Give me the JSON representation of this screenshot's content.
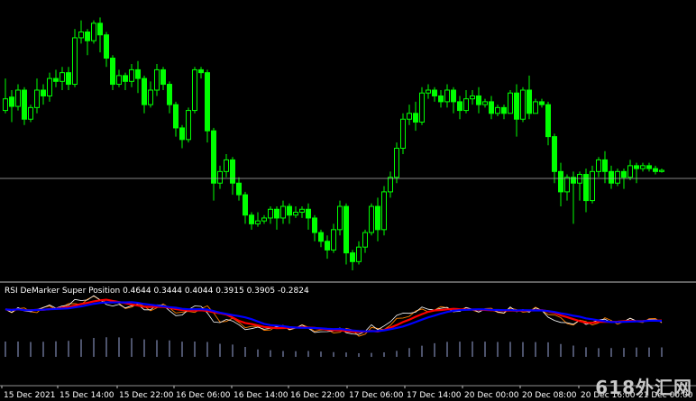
{
  "indicator": {
    "name": "RSI DeMarker Super Position",
    "values": [
      "0.4644",
      "0.3444",
      "0.4044",
      "0.3915",
      "0.3905",
      "-0.2824"
    ]
  },
  "watermark": "618外汇网",
  "colors": {
    "background": "#000000",
    "candle": "#00ff00",
    "wick": "#00ff00",
    "hline": "#c0c0c0",
    "separator": "#c0c0c0",
    "rsi_line": "#ffffff",
    "demarker_line": "#ff8000",
    "ma_red": "#ff0000",
    "ma_blue": "#0000ff",
    "histogram": "#9aa6d8"
  },
  "chart_data": {
    "type": "candlestick",
    "x_ticks": [
      "15 Dec 2021",
      "15 Dec 14:00",
      "15 Dec 22:00",
      "16 Dec 06:00",
      "16 Dec 14:00",
      "16 Dec 22:00",
      "17 Dec 06:00",
      "17 Dec 14:00",
      "20 Dec 00:00",
      "20 Dec 08:00",
      "20 Dec 16:00",
      "21 Dec 00:00"
    ],
    "price_hline": 0.5,
    "candles": [
      [
        0.605,
        0.625,
        0.6,
        0.66
      ],
      [
        0.628,
        0.612,
        0.585,
        0.64
      ],
      [
        0.612,
        0.64,
        0.605,
        0.65
      ],
      [
        0.64,
        0.59,
        0.58,
        0.645
      ],
      [
        0.59,
        0.61,
        0.585,
        0.615
      ],
      [
        0.61,
        0.64,
        0.6,
        0.66
      ],
      [
        0.64,
        0.63,
        0.615,
        0.65
      ],
      [
        0.63,
        0.66,
        0.62,
        0.67
      ],
      [
        0.66,
        0.655,
        0.645,
        0.675
      ],
      [
        0.655,
        0.67,
        0.64,
        0.68
      ],
      [
        0.67,
        0.65,
        0.64,
        0.68
      ],
      [
        0.65,
        0.73,
        0.645,
        0.745
      ],
      [
        0.73,
        0.74,
        0.72,
        0.76
      ],
      [
        0.74,
        0.725,
        0.7,
        0.745
      ],
      [
        0.725,
        0.755,
        0.72,
        0.76
      ],
      [
        0.755,
        0.735,
        0.705,
        0.765
      ],
      [
        0.735,
        0.695,
        0.68,
        0.74
      ],
      [
        0.695,
        0.65,
        0.64,
        0.7
      ],
      [
        0.65,
        0.665,
        0.645,
        0.675
      ],
      [
        0.665,
        0.655,
        0.64,
        0.67
      ],
      [
        0.655,
        0.675,
        0.645,
        0.685
      ],
      [
        0.675,
        0.66,
        0.635,
        0.69
      ],
      [
        0.66,
        0.615,
        0.6,
        0.665
      ],
      [
        0.615,
        0.64,
        0.61,
        0.655
      ],
      [
        0.64,
        0.675,
        0.63,
        0.685
      ],
      [
        0.675,
        0.65,
        0.64,
        0.68
      ],
      [
        0.65,
        0.615,
        0.6,
        0.655
      ],
      [
        0.615,
        0.575,
        0.56,
        0.62
      ],
      [
        0.575,
        0.555,
        0.54,
        0.58
      ],
      [
        0.555,
        0.605,
        0.55,
        0.61
      ],
      [
        0.605,
        0.675,
        0.6,
        0.68
      ],
      [
        0.675,
        0.67,
        0.66,
        0.68
      ],
      [
        0.67,
        0.57,
        0.55,
        0.675
      ],
      [
        0.57,
        0.48,
        0.45,
        0.575
      ],
      [
        0.48,
        0.5,
        0.47,
        0.51
      ],
      [
        0.5,
        0.52,
        0.49,
        0.53
      ],
      [
        0.52,
        0.48,
        0.46,
        0.525
      ],
      [
        0.48,
        0.46,
        0.45,
        0.49
      ],
      [
        0.46,
        0.425,
        0.41,
        0.465
      ],
      [
        0.425,
        0.41,
        0.4,
        0.43
      ],
      [
        0.41,
        0.415,
        0.405,
        0.43
      ],
      [
        0.415,
        0.42,
        0.41,
        0.425
      ],
      [
        0.42,
        0.435,
        0.41,
        0.44
      ],
      [
        0.435,
        0.42,
        0.4,
        0.44
      ],
      [
        0.42,
        0.44,
        0.41,
        0.45
      ],
      [
        0.44,
        0.425,
        0.41,
        0.445
      ],
      [
        0.425,
        0.43,
        0.42,
        0.44
      ],
      [
        0.43,
        0.435,
        0.42,
        0.44
      ],
      [
        0.435,
        0.42,
        0.4,
        0.445
      ],
      [
        0.42,
        0.395,
        0.38,
        0.425
      ],
      [
        0.395,
        0.38,
        0.37,
        0.4
      ],
      [
        0.38,
        0.365,
        0.35,
        0.39
      ],
      [
        0.365,
        0.4,
        0.36,
        0.41
      ],
      [
        0.4,
        0.44,
        0.39,
        0.45
      ],
      [
        0.44,
        0.36,
        0.34,
        0.445
      ],
      [
        0.36,
        0.345,
        0.33,
        0.365
      ],
      [
        0.345,
        0.37,
        0.34,
        0.38
      ],
      [
        0.37,
        0.395,
        0.36,
        0.4
      ],
      [
        0.395,
        0.44,
        0.39,
        0.445
      ],
      [
        0.44,
        0.4,
        0.38,
        0.455
      ],
      [
        0.4,
        0.465,
        0.39,
        0.475
      ],
      [
        0.465,
        0.49,
        0.455,
        0.5
      ],
      [
        0.49,
        0.54,
        0.48,
        0.55
      ],
      [
        0.54,
        0.59,
        0.53,
        0.6
      ],
      [
        0.59,
        0.6,
        0.58,
        0.615
      ],
      [
        0.6,
        0.585,
        0.57,
        0.62
      ],
      [
        0.585,
        0.635,
        0.58,
        0.645
      ],
      [
        0.635,
        0.64,
        0.625,
        0.65
      ],
      [
        0.64,
        0.63,
        0.62,
        0.645
      ],
      [
        0.63,
        0.62,
        0.61,
        0.64
      ],
      [
        0.62,
        0.64,
        0.61,
        0.65
      ],
      [
        0.64,
        0.62,
        0.6,
        0.645
      ],
      [
        0.62,
        0.605,
        0.59,
        0.63
      ],
      [
        0.605,
        0.625,
        0.6,
        0.64
      ],
      [
        0.625,
        0.63,
        0.615,
        0.64
      ],
      [
        0.63,
        0.615,
        0.6,
        0.645
      ],
      [
        0.615,
        0.62,
        0.61,
        0.625
      ],
      [
        0.62,
        0.6,
        0.59,
        0.63
      ],
      [
        0.6,
        0.61,
        0.595,
        0.615
      ],
      [
        0.61,
        0.6,
        0.59,
        0.615
      ],
      [
        0.6,
        0.635,
        0.6,
        0.64
      ],
      [
        0.635,
        0.59,
        0.56,
        0.65
      ],
      [
        0.59,
        0.64,
        0.585,
        0.645
      ],
      [
        0.64,
        0.6,
        0.59,
        0.665
      ],
      [
        0.6,
        0.62,
        0.6,
        0.625
      ],
      [
        0.62,
        0.615,
        0.61,
        0.625
      ],
      [
        0.615,
        0.56,
        0.545,
        0.62
      ],
      [
        0.56,
        0.5,
        0.48,
        0.565
      ],
      [
        0.5,
        0.465,
        0.44,
        0.515
      ],
      [
        0.465,
        0.49,
        0.45,
        0.495
      ],
      [
        0.49,
        0.48,
        0.41,
        0.5
      ],
      [
        0.48,
        0.495,
        0.45,
        0.5
      ],
      [
        0.495,
        0.45,
        0.43,
        0.505
      ],
      [
        0.45,
        0.5,
        0.445,
        0.51
      ],
      [
        0.5,
        0.52,
        0.49,
        0.525
      ],
      [
        0.52,
        0.5,
        0.48,
        0.535
      ],
      [
        0.5,
        0.48,
        0.47,
        0.51
      ],
      [
        0.48,
        0.5,
        0.475,
        0.505
      ],
      [
        0.5,
        0.49,
        0.47,
        0.505
      ],
      [
        0.49,
        0.51,
        0.485,
        0.52
      ],
      [
        0.51,
        0.505,
        0.48,
        0.515
      ],
      [
        0.505,
        0.51,
        0.5,
        0.515
      ],
      [
        0.51,
        0.505,
        0.5,
        0.515
      ],
      [
        0.505,
        0.5,
        0.495,
        0.51
      ],
      [
        0.5,
        0.502,
        0.498,
        0.505
      ]
    ]
  }
}
